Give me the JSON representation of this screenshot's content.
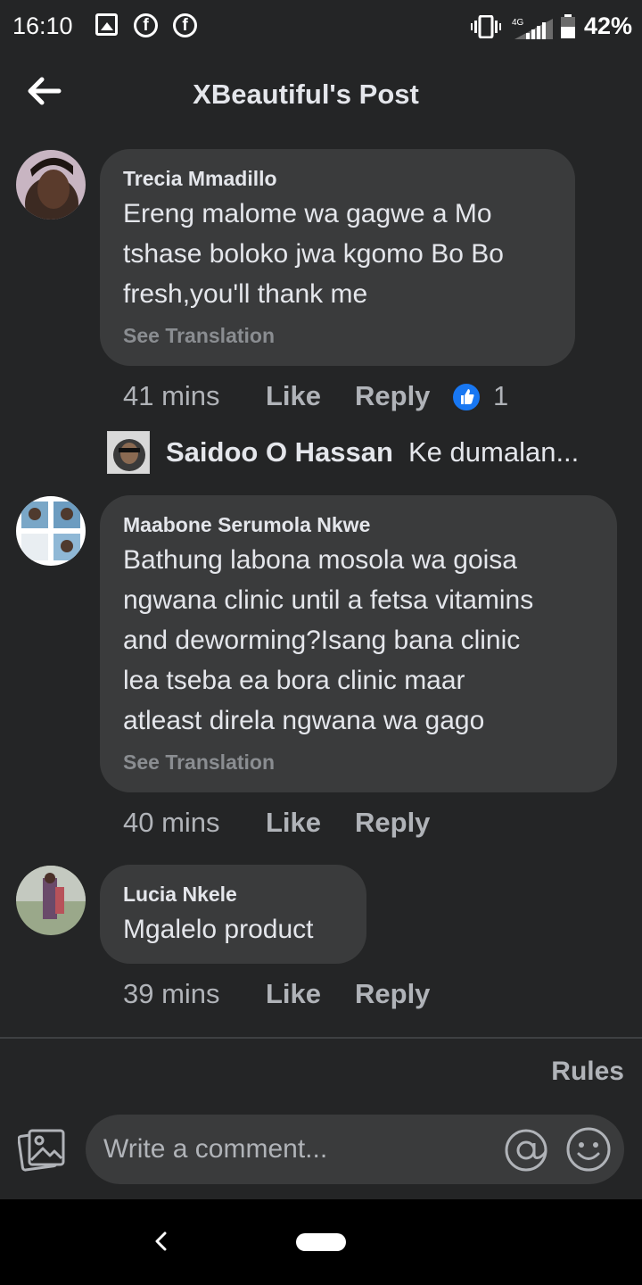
{
  "status_bar": {
    "time": "16:10",
    "network": "4G",
    "battery": "42%",
    "icons": [
      "image-icon",
      "facebook-icon",
      "facebook-icon",
      "vibrate-icon",
      "signal-icon",
      "battery-icon"
    ]
  },
  "header": {
    "title": "XBeautiful's Post",
    "back_icon": "arrow-left-icon"
  },
  "comments": [
    {
      "author": "Trecia Mmadillo",
      "text": "Ereng malome wa gagwe a Mo\ntshase boloko jwa kgomo Bo Bo\nfresh,you'll thank me",
      "translation_link": "See Translation",
      "time": "41 mins",
      "like_label": "Like",
      "reply_label": "Reply",
      "reaction_count": "1",
      "reply_preview": {
        "author": "Saidoo O Hassan",
        "text": "Ke dumalan..."
      }
    },
    {
      "author": "Maabone Serumola Nkwe",
      "text": "Bathung labona mosola wa goisa\nngwana clinic until a fetsa vitamins\nand deworming?Isang bana clinic\nlea tseba ea bora  clinic maar\natleast direla ngwana wa gago",
      "translation_link": "See Translation",
      "time": "40 mins",
      "like_label": "Like",
      "reply_label": "Reply"
    },
    {
      "author": "Lucia Nkele",
      "text": "Mgalelo product",
      "time": "39 mins",
      "like_label": "Like",
      "reply_label": "Reply"
    }
  ],
  "composer": {
    "rules_label": "Rules",
    "placeholder": "Write a comment..."
  },
  "colors": {
    "background": "#242526",
    "bubble": "#3a3b3c",
    "text_primary": "#e4e6eb",
    "text_secondary": "#b0b3b8",
    "like_blue": "#1877f2"
  }
}
